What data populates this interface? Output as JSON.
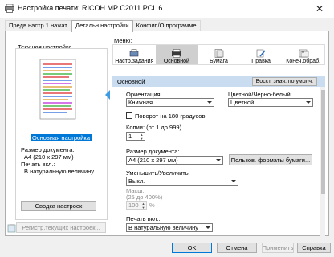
{
  "window": {
    "title": "Настройка печати: RICOH MP C2011 PCL 6",
    "close_glyph": "✕"
  },
  "tabs": [
    {
      "label": "Предв.настр.1 нажат."
    },
    {
      "label": "Детальн.настройки"
    },
    {
      "label": "Конфиг./О программе"
    }
  ],
  "left_panel": {
    "header": "Текущая настройка",
    "selected_setting": "Основная настройка",
    "info_lines": [
      "Размер документа:",
      "  A4 (210 x 297 мм)",
      "Печать вкл.:",
      "  В натуральную величину"
    ],
    "summary_button": "Сводка настроек",
    "register_button": "Регистр.текущих настроек..."
  },
  "menu": {
    "label": "Меню:",
    "items": [
      {
        "label": "Настр.задания",
        "icon": "job-settings-icon"
      },
      {
        "label": "Основной",
        "icon": "basic-icon"
      },
      {
        "label": "Бумага",
        "icon": "paper-icon"
      },
      {
        "label": "Правка",
        "icon": "edit-icon"
      },
      {
        "label": "Конеч.обраб.",
        "icon": "finishing-icon"
      }
    ]
  },
  "section": {
    "name": "Основной",
    "reset_button": "Восст. знач. по умолч."
  },
  "form": {
    "orientation_label": "Ориентация:",
    "orientation_value": "Книжная",
    "color_label": "Цветной/Черно-белый:",
    "color_value": "Цветной",
    "rotate_label": "Поворот на 180 градусов",
    "copies_label": "Копии: (от 1 до 999)",
    "copies_value": "1",
    "doc_size_label": "Размер документа:",
    "doc_size_value": "A4 (210 x 297 мм)",
    "custom_paper_button": "Пользов. формаᴛы бумаги...",
    "zoom_label": "Уменьшить/Увеличить:",
    "zoom_value": "Выкл.",
    "scale_label": "Масш:",
    "scale_range": "(25 до 400%)",
    "scale_value": "100",
    "scale_unit": "%",
    "print_on_label": "Печать вкл.:",
    "print_on_value": "В натуральную величину"
  },
  "buttons": {
    "ok": "OK",
    "cancel": "Отмена",
    "apply": "Применить",
    "help": "Справка"
  },
  "colors": {
    "accent": "#0078d7",
    "section_bar": "#c9dcf0",
    "arrow": "#3c9be3"
  }
}
